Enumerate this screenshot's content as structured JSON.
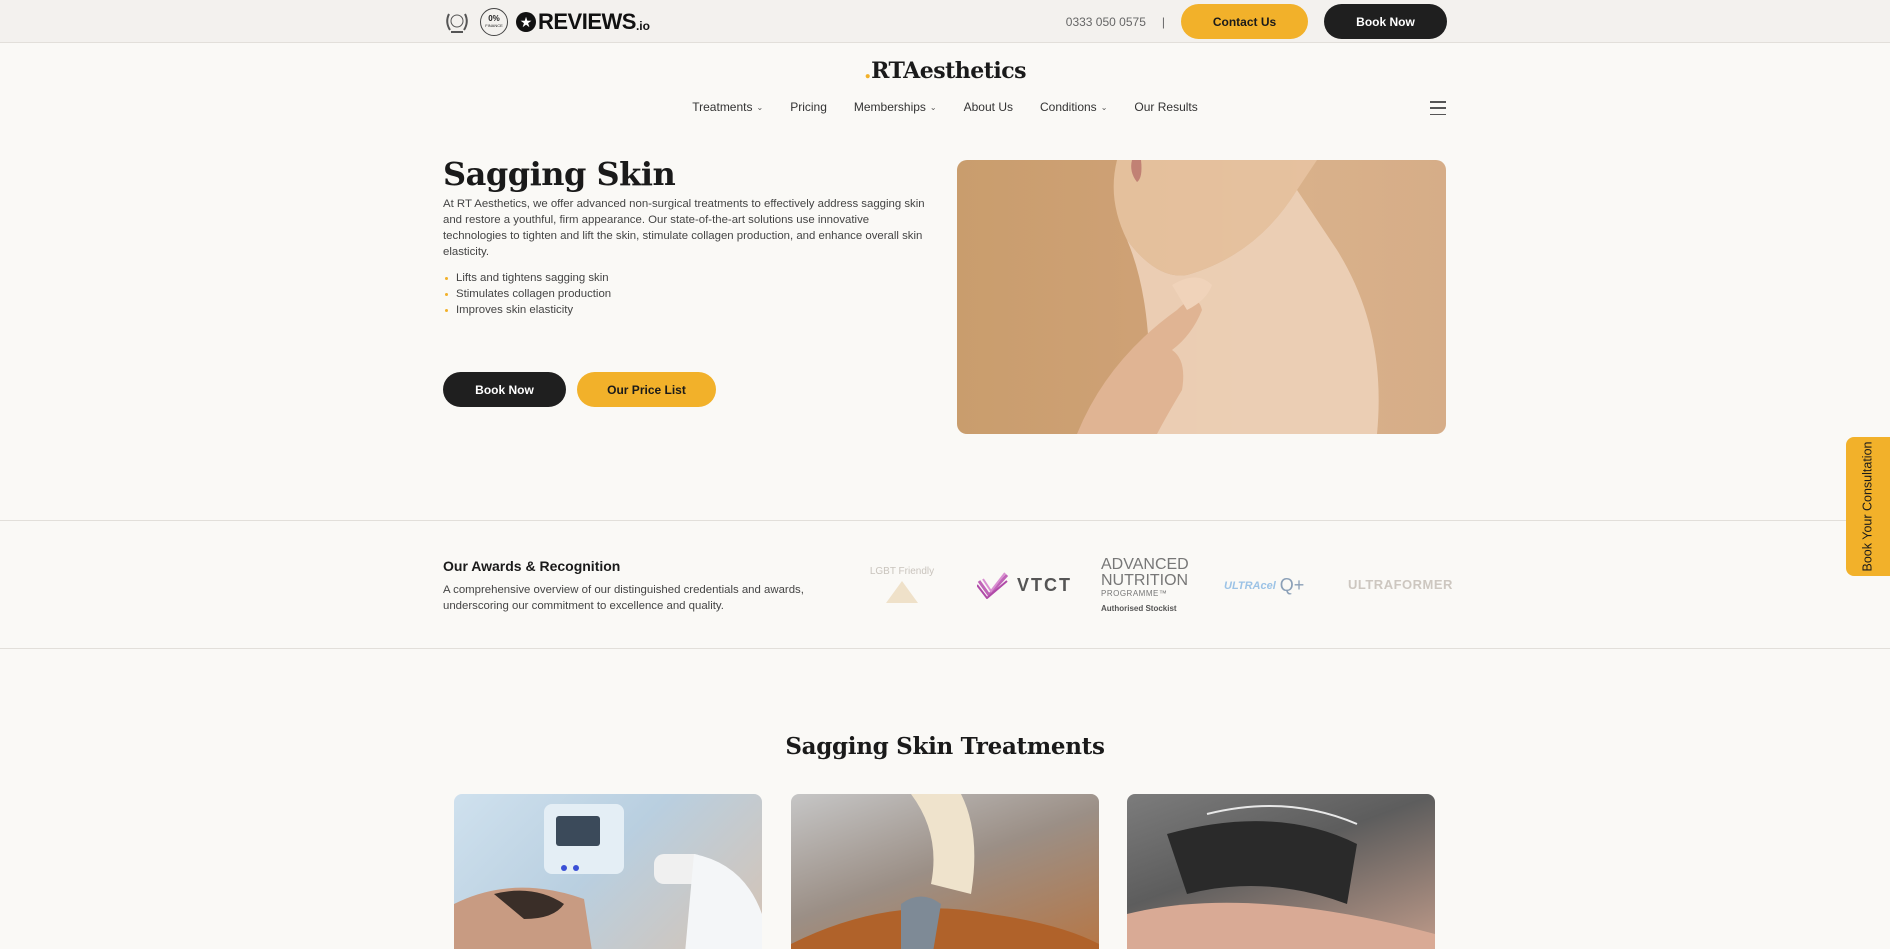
{
  "topbar": {
    "badge_zero_big": "0%",
    "badge_zero_small": "FINANCE",
    "reviews_word": "REVIEWS",
    "reviews_suffix": ".io",
    "phone": "0333 050 0575",
    "separator": "|",
    "contact_label": "Contact Us",
    "book_label": "Book Now"
  },
  "header": {
    "logo": "RTAesthetics",
    "nav": {
      "treatments": "Treatments",
      "pricing": "Pricing",
      "memberships": "Memberships",
      "about": "About Us",
      "conditions": "Conditions",
      "results": "Our Results"
    }
  },
  "hero": {
    "title": "Sagging Skin",
    "description": "At RT Aesthetics, we offer advanced non-surgical treatments to effectively address sagging skin and restore a youthful, firm appearance. Our state-of-the-art solutions use innovative technologies to tighten and lift the skin, stimulate collagen production, and enhance overall skin elasticity.",
    "bullets": [
      "Lifts and tightens sagging skin",
      "Stimulates collagen production",
      "Improves skin elasticity"
    ],
    "book_label": "Book Now",
    "price_label": "Our Price List"
  },
  "awards": {
    "title": "Our Awards & Recognition",
    "description": "A comprehensive overview of our distinguished credentials and awards, underscoring our commitment to excellence and quality.",
    "lgbt": "LGBT Friendly",
    "vtct": "VTCT",
    "adv_line1": "ADVANCED",
    "adv_line2": "NUTRITION",
    "adv_line3": "PROGRAMME™",
    "adv_auth": "Authorised Stockist",
    "ultra_a": "ULTRAcel",
    "ultra_b": "Q+",
    "ultraformer": "ULTRAFORMER"
  },
  "treatments": {
    "title": "Sagging Skin Treatments"
  },
  "sidetab": {
    "label": "Book Your Consultation"
  },
  "colors": {
    "accent": "#f2b12a",
    "dark": "#1f1f1f",
    "background": "#faf9f6"
  }
}
